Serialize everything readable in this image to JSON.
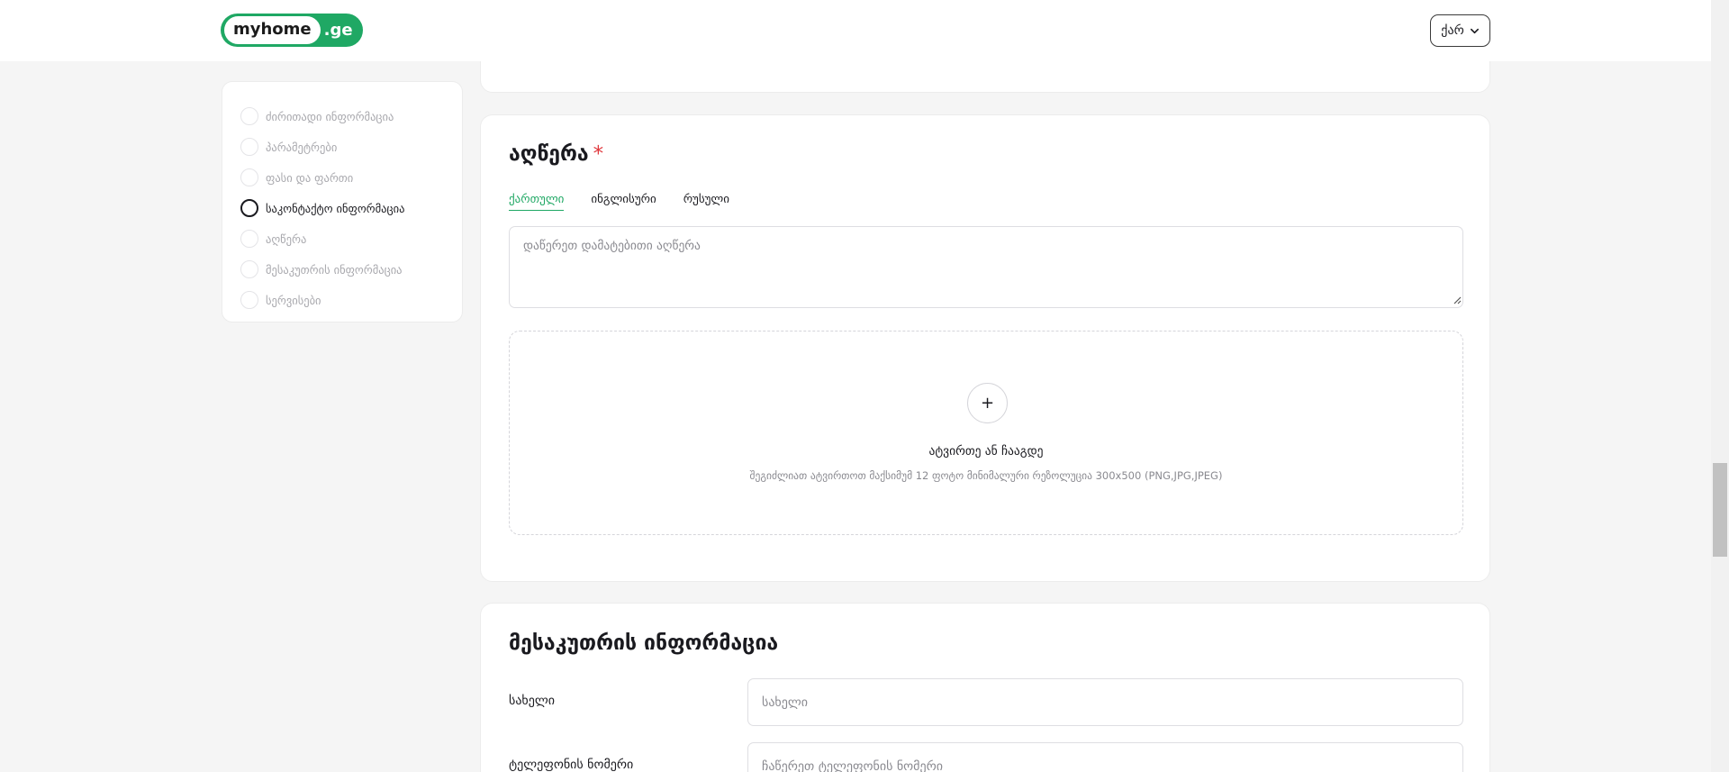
{
  "header": {
    "logo_main": "myhome",
    "logo_ext": ".ge",
    "language": "ქარ"
  },
  "sidebar": {
    "steps": [
      {
        "label": "ძირითადი ინფორმაცია",
        "active": false
      },
      {
        "label": "პარამეტრები",
        "active": false
      },
      {
        "label": "ფასი და ფართი",
        "active": false
      },
      {
        "label": "საკონტაქტო ინფორმაცია",
        "active": true
      },
      {
        "label": "აღწერა",
        "active": false
      },
      {
        "label": "მესაკუთრის ინფორმაცია",
        "active": false
      },
      {
        "label": "სერვისები",
        "active": false
      }
    ]
  },
  "description": {
    "title": "აღწერა",
    "required_mark": "*",
    "tabs": [
      {
        "label": "ქართული",
        "active": true
      },
      {
        "label": "ინგლისური",
        "active": false
      },
      {
        "label": "რუსული",
        "active": false
      }
    ],
    "textarea_placeholder": "დაწერეთ დამატებითი აღწერა",
    "upload": {
      "plus": "+",
      "title": "ატვირთე ან ჩააგდე",
      "hint": "შეგიძლიათ ატვირთოთ მაქსიმუმ 12 ფოტო მინიმალური რეზოლუცია 300x500 (PNG,JPG,JPEG)"
    }
  },
  "owner": {
    "title": "მესაკუთრის ინფორმაცია",
    "name_label": "სახელი",
    "name_placeholder": "სახელი",
    "phone_label": "ტელეფონის ნომერი",
    "phone_placeholder": "ჩაწერეთ ტელეფონის ნომერი"
  },
  "colors": {
    "brand": "#1fa864",
    "required": "#e0393e"
  }
}
